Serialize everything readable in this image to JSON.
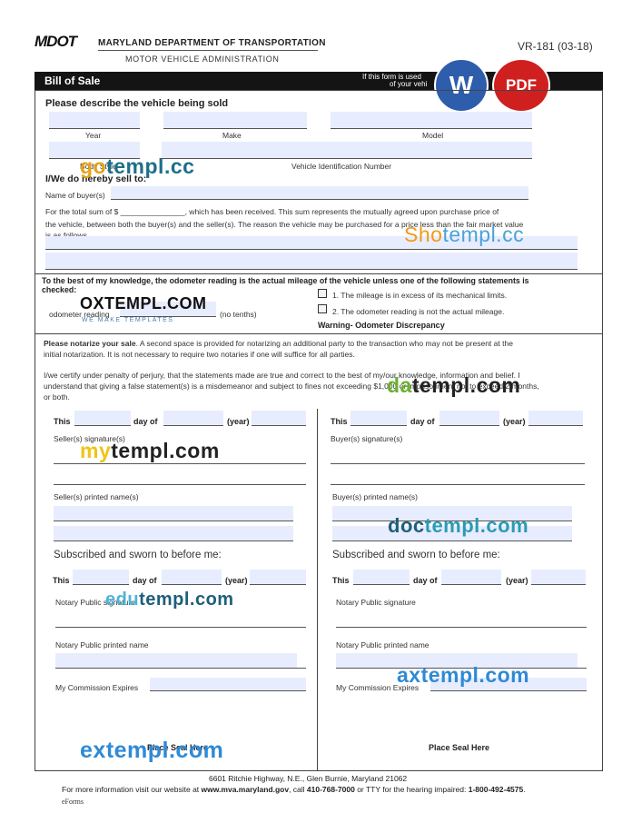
{
  "header": {
    "logo_text": "MDOT",
    "dept": "MARYLAND DEPARTMENT OF TRANSPORTATION",
    "sub": "MOTOR VEHICLE ADMINISTRATION",
    "form_no": "VR-181 (03-18)"
  },
  "title_bar": {
    "title": "Bill of Sale",
    "note_line1": "If this form is used",
    "note_line2": "of your vehi"
  },
  "badges": {
    "word": "W",
    "pdf": "PDF"
  },
  "section1": {
    "heading": "Please describe the vehicle being sold",
    "year": "Year",
    "make": "Make",
    "model": "Model",
    "body_style": "Body Style",
    "vin": "Vehicle Identification Number",
    "sell_to": "I/We do hereby sell to:",
    "buyer_name": "Name of buyer(s)",
    "sum_line1": "For the total sum of $ _______________, which has been received. This sum represents the mutually agreed upon purchase price of",
    "sum_line2": "the vehicle, between both the buyer(s) and the seller(s).  The reason the vehicle may be purchased for a price less than the fair market value",
    "sum_line3": "is as follows."
  },
  "section2": {
    "heading_line1": "To the best of my knowledge, the odometer reading is the actual mileage of the vehicle unless one of the following statements is",
    "heading_line2": "checked:",
    "odometer": "odometer reading",
    "no_tenths": "(no tenths)",
    "opt1": "1. The mileage is in excess of its mechanical limits.",
    "opt2": "2. The odometer reading is not the actual mileage.",
    "warning": "Warning- Odometer Discrepancy"
  },
  "section3": {
    "notarize_bold": "Please notarize your sale",
    "notarize_rest": ". A second space is provided for notarizing an additional party to the transaction who may not be present at the",
    "notarize_line2": "initial notarization. It is not necessary to require two notaries if one will suffice for all parties.",
    "certify1": "I/we certify under penalty of perjury, that the statements made are true and correct to the best of my/our knowledge, information and belief. I",
    "certify2": "understand that giving a false statement(s) is a misdemeanor and subject to fines not exceeding $1,000 or imprisonment not to exceed 2 months,",
    "certify3": "or both.",
    "this": "This",
    "day_of": "day of",
    "year": "(year)",
    "seller_sig": "Seller(s) signature(s)",
    "buyer_sig": "Buyer(s) signature(s)",
    "seller_print": "Seller(s) printed name(s)",
    "buyer_print": "Buyer(s) printed name(s)",
    "sworn": "Subscribed and sworn to before me:",
    "notary_sig": "Notary Public signature",
    "notary_print": "Notary Public printed name",
    "commission": "My Commission Expires",
    "seal": "Place Seal Here"
  },
  "footer": {
    "address": "6601 Ritchie Highway, N.E., Glen Burnie, Maryland 21062",
    "info_pre": "For more information visit our website at ",
    "site": "www.mva.maryland.gov",
    "info_mid": ", call ",
    "phone": "410-768-7000",
    "info_mid2": " or TTY for the hearing impaired: ",
    "tty": "1-800-492-4575",
    "info_end": ".",
    "eforms": "eForms"
  },
  "watermarks": {
    "w1a": "go",
    "w1b": "templ.cc",
    "w2a": "Sho",
    "w2b": "templ.cc",
    "w3": "OXTEMPL.COM",
    "w3sub": "WE MAKE TEMPLATES",
    "w4a": "da",
    "w4b": "templ.com",
    "w5a": "my",
    "w5b": "templ.com",
    "w6a": "doc",
    "w6b": "templ.com",
    "w7a": "edu",
    "w7b": "templ.com",
    "w8a": "ax",
    "w8b": "templ.com",
    "w9a": "ex",
    "w9b": "templ.com"
  }
}
